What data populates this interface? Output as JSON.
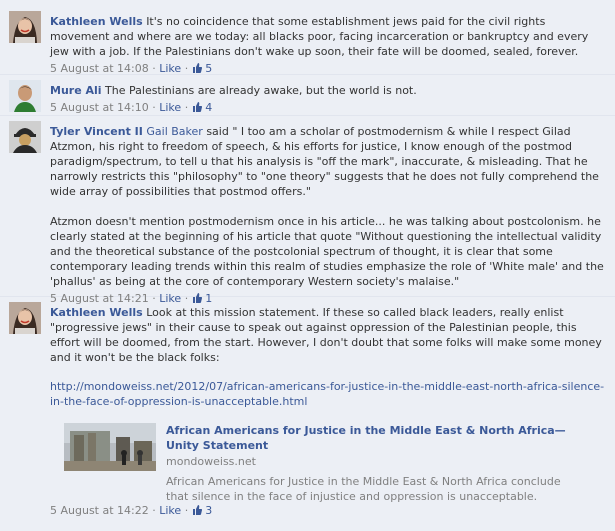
{
  "comments": [
    {
      "author": "Kathleen Wells",
      "text": "It's no coincidence that some establishment jews paid for the civil rights movement and where are we today: all blacks poor, facing incarceration or bankruptcy and every jew with a job. If the Palestinians don't wake up soon, their fate will be doomed, sealed, forever.",
      "time": "5 August at 14:08",
      "like_label": "Like",
      "likes": "5"
    },
    {
      "author": "Mure Ali",
      "text": "The Palestinians are already awake, but the world is not.",
      "time": "5 August at 14:10",
      "like_label": "Like",
      "likes": "4"
    },
    {
      "author": "Tyler Vincent II",
      "mention": "Gail Baker",
      "text": "said \" I too am a scholar of postmodernism & while I respect Gilad Atzmon, his right to freedom of speech, & his efforts for justice, I know enough of the postmod paradigm/spectrum, to tell u that his analysis is \"off the mark\", inaccurate, & misleading. That he narrowly restricts this \"philosophy\" to \"one theory\" suggests that he does not fully comprehend the wide array of possibilities that postmod offers.\"",
      "text2": "Atzmon doesn't mention postmodernism once in his article... he was talking about postcolonism. he clearly stated at the beginning of his article that quote \"Without questioning the intellectual validity and the theoretical substance of the postcolonial spectrum of thought, it is clear that some contemporary leading trends within this realm of studies emphasize the role of 'White male' and the 'phallus' as being at the core of contemporary Western society's malaise.\"",
      "time": "5 August at 14:21",
      "like_label": "Like",
      "likes": "1"
    },
    {
      "author": "Kathleen Wells",
      "text": "Look at this mission statement. If these so called black leaders, really enlist \"progressive jews\" in their cause to speak out against oppression of the Palestinian people, this effort will be doomed, from the start. However, I don't doubt that some folks will make some money and it won't be the black folks:",
      "url": "http://mondoweiss.net/2012/07/african-americans-for-justice-in-the-middle-east-north-africa-silence-in-the-face-of-oppression-is-unacceptable.html",
      "preview": {
        "title": "African Americans for Justice in the Middle East & North Africa—Unity Statement",
        "site": "mondoweiss.net",
        "description": "African Americans for Justice in the Middle East & North Africa conclude that silence in the face of injustice and oppression is unacceptable."
      },
      "time": "5 August at 14:22",
      "like_label": "Like",
      "likes": "3"
    }
  ],
  "separator": "·",
  "icons": {
    "like_thumb": "thumbs-up-icon"
  },
  "colors": {
    "link": "#3b5998",
    "background": "#eceff5",
    "muted": "#808080"
  }
}
